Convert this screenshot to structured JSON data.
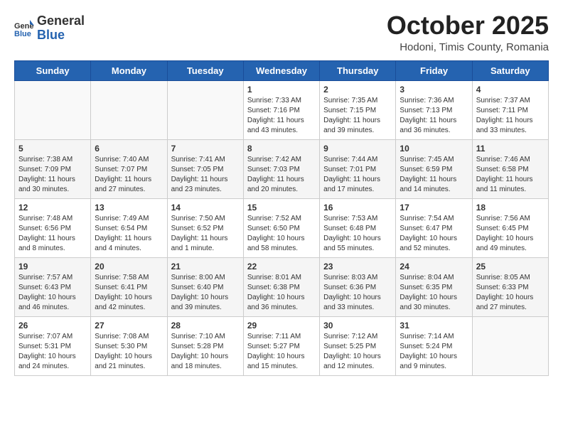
{
  "header": {
    "logo_general": "General",
    "logo_blue": "Blue",
    "month_title": "October 2025",
    "subtitle": "Hodoni, Timis County, Romania"
  },
  "days_of_week": [
    "Sunday",
    "Monday",
    "Tuesday",
    "Wednesday",
    "Thursday",
    "Friday",
    "Saturday"
  ],
  "weeks": [
    [
      {
        "day": "",
        "info": ""
      },
      {
        "day": "",
        "info": ""
      },
      {
        "day": "",
        "info": ""
      },
      {
        "day": "1",
        "info": "Sunrise: 7:33 AM\nSunset: 7:16 PM\nDaylight: 11 hours\nand 43 minutes."
      },
      {
        "day": "2",
        "info": "Sunrise: 7:35 AM\nSunset: 7:15 PM\nDaylight: 11 hours\nand 39 minutes."
      },
      {
        "day": "3",
        "info": "Sunrise: 7:36 AM\nSunset: 7:13 PM\nDaylight: 11 hours\nand 36 minutes."
      },
      {
        "day": "4",
        "info": "Sunrise: 7:37 AM\nSunset: 7:11 PM\nDaylight: 11 hours\nand 33 minutes."
      }
    ],
    [
      {
        "day": "5",
        "info": "Sunrise: 7:38 AM\nSunset: 7:09 PM\nDaylight: 11 hours\nand 30 minutes."
      },
      {
        "day": "6",
        "info": "Sunrise: 7:40 AM\nSunset: 7:07 PM\nDaylight: 11 hours\nand 27 minutes."
      },
      {
        "day": "7",
        "info": "Sunrise: 7:41 AM\nSunset: 7:05 PM\nDaylight: 11 hours\nand 23 minutes."
      },
      {
        "day": "8",
        "info": "Sunrise: 7:42 AM\nSunset: 7:03 PM\nDaylight: 11 hours\nand 20 minutes."
      },
      {
        "day": "9",
        "info": "Sunrise: 7:44 AM\nSunset: 7:01 PM\nDaylight: 11 hours\nand 17 minutes."
      },
      {
        "day": "10",
        "info": "Sunrise: 7:45 AM\nSunset: 6:59 PM\nDaylight: 11 hours\nand 14 minutes."
      },
      {
        "day": "11",
        "info": "Sunrise: 7:46 AM\nSunset: 6:58 PM\nDaylight: 11 hours\nand 11 minutes."
      }
    ],
    [
      {
        "day": "12",
        "info": "Sunrise: 7:48 AM\nSunset: 6:56 PM\nDaylight: 11 hours\nand 8 minutes."
      },
      {
        "day": "13",
        "info": "Sunrise: 7:49 AM\nSunset: 6:54 PM\nDaylight: 11 hours\nand 4 minutes."
      },
      {
        "day": "14",
        "info": "Sunrise: 7:50 AM\nSunset: 6:52 PM\nDaylight: 11 hours\nand 1 minute."
      },
      {
        "day": "15",
        "info": "Sunrise: 7:52 AM\nSunset: 6:50 PM\nDaylight: 10 hours\nand 58 minutes."
      },
      {
        "day": "16",
        "info": "Sunrise: 7:53 AM\nSunset: 6:48 PM\nDaylight: 10 hours\nand 55 minutes."
      },
      {
        "day": "17",
        "info": "Sunrise: 7:54 AM\nSunset: 6:47 PM\nDaylight: 10 hours\nand 52 minutes."
      },
      {
        "day": "18",
        "info": "Sunrise: 7:56 AM\nSunset: 6:45 PM\nDaylight: 10 hours\nand 49 minutes."
      }
    ],
    [
      {
        "day": "19",
        "info": "Sunrise: 7:57 AM\nSunset: 6:43 PM\nDaylight: 10 hours\nand 46 minutes."
      },
      {
        "day": "20",
        "info": "Sunrise: 7:58 AM\nSunset: 6:41 PM\nDaylight: 10 hours\nand 42 minutes."
      },
      {
        "day": "21",
        "info": "Sunrise: 8:00 AM\nSunset: 6:40 PM\nDaylight: 10 hours\nand 39 minutes."
      },
      {
        "day": "22",
        "info": "Sunrise: 8:01 AM\nSunset: 6:38 PM\nDaylight: 10 hours\nand 36 minutes."
      },
      {
        "day": "23",
        "info": "Sunrise: 8:03 AM\nSunset: 6:36 PM\nDaylight: 10 hours\nand 33 minutes."
      },
      {
        "day": "24",
        "info": "Sunrise: 8:04 AM\nSunset: 6:35 PM\nDaylight: 10 hours\nand 30 minutes."
      },
      {
        "day": "25",
        "info": "Sunrise: 8:05 AM\nSunset: 6:33 PM\nDaylight: 10 hours\nand 27 minutes."
      }
    ],
    [
      {
        "day": "26",
        "info": "Sunrise: 7:07 AM\nSunset: 5:31 PM\nDaylight: 10 hours\nand 24 minutes."
      },
      {
        "day": "27",
        "info": "Sunrise: 7:08 AM\nSunset: 5:30 PM\nDaylight: 10 hours\nand 21 minutes."
      },
      {
        "day": "28",
        "info": "Sunrise: 7:10 AM\nSunset: 5:28 PM\nDaylight: 10 hours\nand 18 minutes."
      },
      {
        "day": "29",
        "info": "Sunrise: 7:11 AM\nSunset: 5:27 PM\nDaylight: 10 hours\nand 15 minutes."
      },
      {
        "day": "30",
        "info": "Sunrise: 7:12 AM\nSunset: 5:25 PM\nDaylight: 10 hours\nand 12 minutes."
      },
      {
        "day": "31",
        "info": "Sunrise: 7:14 AM\nSunset: 5:24 PM\nDaylight: 10 hours\nand 9 minutes."
      },
      {
        "day": "",
        "info": ""
      }
    ]
  ]
}
